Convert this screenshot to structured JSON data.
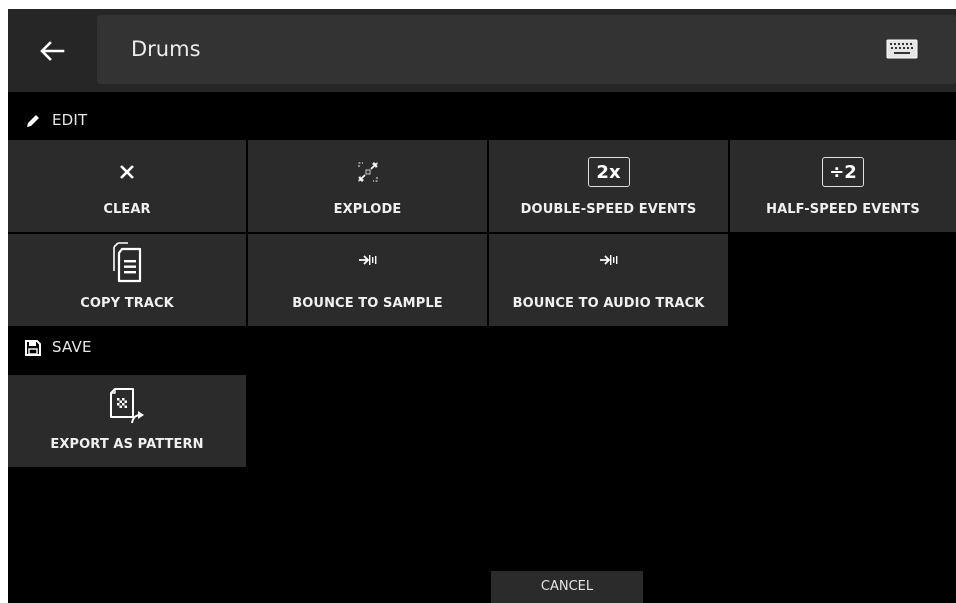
{
  "header": {
    "back_icon": "arrow-left-icon",
    "name_value": "Drums",
    "keyboard_icon": "keyboard-icon"
  },
  "sections": {
    "edit": {
      "label": "EDIT",
      "icon": "pencil-icon"
    },
    "save": {
      "label": "SAVE",
      "icon": "floppy-disk-icon"
    }
  },
  "edit_buttons": {
    "clear": {
      "label": "CLEAR",
      "icon": "x-icon"
    },
    "explode": {
      "label": "EXPLODE",
      "icon": "explode-icon"
    },
    "double_speed": {
      "label": "DOUBLE-SPEED EVENTS",
      "icon_text": "2x"
    },
    "half_speed": {
      "label": "HALF-SPEED EVENTS",
      "icon_text": "÷2"
    },
    "copy_track": {
      "label": "COPY TRACK",
      "icon": "copy-document-icon"
    },
    "bounce_sample": {
      "label": "BOUNCE TO SAMPLE",
      "icon": "bounce-icon"
    },
    "bounce_audio": {
      "label": "BOUNCE TO AUDIO TRACK",
      "icon": "bounce-icon"
    }
  },
  "save_buttons": {
    "export_pattern": {
      "label": "EXPORT AS PATTERN",
      "icon": "export-document-icon"
    }
  },
  "footer": {
    "cancel_label": "CANCEL"
  },
  "colors": {
    "background": "#000000",
    "header": "#262626",
    "field": "#333333",
    "button": "#2b2b2b",
    "text": "#f0f0f0"
  }
}
